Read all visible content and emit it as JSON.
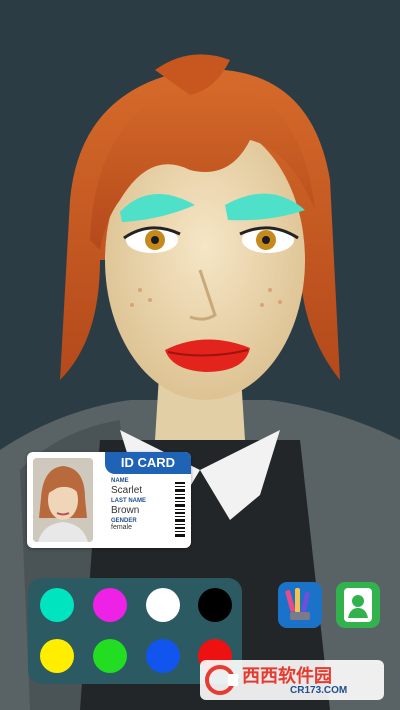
{
  "id_card": {
    "title": "ID CARD",
    "name_label": "NAME",
    "name": "Scarlet",
    "last_name_label": "LAST NAME",
    "last_name": "Brown",
    "gender_label": "GENDER",
    "gender": "female"
  },
  "palette": {
    "colors": [
      "#00e5c0",
      "#ee22e6",
      "#ffffff",
      "#000000",
      "#ffee00",
      "#22dd22",
      "#1155ee",
      "#ee1111"
    ]
  },
  "tools": [
    {
      "icon": "makeup-brushes-icon"
    },
    {
      "icon": "profile-person-icon"
    }
  ],
  "watermark": {
    "brand": "西西软件园",
    "url": "CR173.COM"
  }
}
